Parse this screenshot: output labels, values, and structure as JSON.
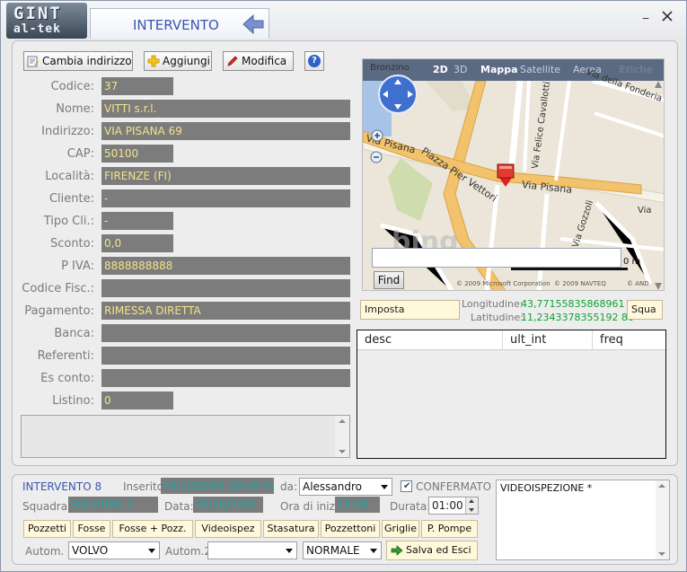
{
  "window": {
    "logo_top": "GINT",
    "logo_bottom": "al-tek",
    "title": "INTERVENTO",
    "minimize": "_",
    "close": "✕"
  },
  "toolbar": {
    "change_address": "Cambia indirizzo",
    "add": "Aggiungi",
    "edit": "Modifica",
    "help": "?"
  },
  "fields": [
    {
      "label": "Codice:",
      "value": "37"
    },
    {
      "label": "Nome:",
      "value": "VITTI s.r.l."
    },
    {
      "label": "Indirizzo:",
      "value": "VIA PISANA 69"
    },
    {
      "label": "CAP:",
      "value": "50100"
    },
    {
      "label": "Località:",
      "value": "FIRENZE (FI)"
    },
    {
      "label": "Cliente:",
      "value": "-"
    },
    {
      "label": "Tipo Cli.:",
      "value": "-"
    },
    {
      "label": "Sconto:",
      "value": "0,0"
    },
    {
      "label": "P IVA:",
      "value": "8888888888"
    },
    {
      "label": "Codice Fisc.:",
      "value": ""
    },
    {
      "label": "Pagamento:",
      "value": "RIMESSA DIRETTA"
    },
    {
      "label": "Banca:",
      "value": ""
    },
    {
      "label": "Referenti:",
      "value": ""
    },
    {
      "label": "Es conto:",
      "value": ""
    },
    {
      "label": "Listino:",
      "value": "0"
    }
  ],
  "map": {
    "tabs": {
      "d2": "2D",
      "d3": "3D",
      "road": "Mappa",
      "satellite": "Satellite",
      "aerial": "Aerea",
      "labels": "Etiche"
    },
    "streets": {
      "bronzino": "Bronzino",
      "fonderia": "Via della Fonderia",
      "cavallotti": "Via Felice Cavallotti",
      "pisana_left": "Via Pisana",
      "vettori": "Piazza Pier Vettori",
      "pisana_right": "Via Pisana",
      "gozzoli": "Via Gozzoli",
      "via_edge": "Via"
    },
    "find": "Find",
    "scale": "0 m",
    "copy_ms": "© 2009 Microsoft Corporation",
    "copy_nav": "© 2009 NAVTEQ",
    "copy_and": "© AND",
    "watermark": "bing"
  },
  "geo": {
    "imposta": "Imposta",
    "lon_label": "Longitudine:",
    "lon_value": "43,77155835868961",
    "lat_label": "Latitudine:",
    "lat_value": "11,2343378355192 86",
    "squadra_btn": "Squa"
  },
  "grid": {
    "columns": [
      "desc",
      "ult_int",
      "freq"
    ]
  },
  "intervento": {
    "title": "INTERVENTO 8",
    "inserito_label": "Inserito:",
    "inserito_value": "30/10/2009 09:28:49",
    "da_label": "da:",
    "da_value": "Alessandro",
    "confermato_label": "CONFERMATO",
    "squadra_label": "Squadra:",
    "squadra_value": "SQUADRA 1",
    "data_label": "Data:",
    "data_value": "30/10/2009",
    "ora_label": "Ora di inizio:",
    "ora_value": "13:00",
    "durata_label": "Durata:",
    "durata_value": "01:00",
    "memo": "VIDEOISPEZIONE *",
    "services": [
      "Pozzetti",
      "Fosse",
      "Fosse + Pozz.",
      "Videoispez",
      "Stasatura",
      "Pozzettoni",
      "Griglie",
      "P. Pompe"
    ],
    "autom1_label": "Autom. 1",
    "autom1_value": "VOLVO",
    "autom2_label": "Autom.2",
    "autom2_value": "",
    "priority_value": "NORMALE",
    "save_label": "Salva ed Esci"
  }
}
